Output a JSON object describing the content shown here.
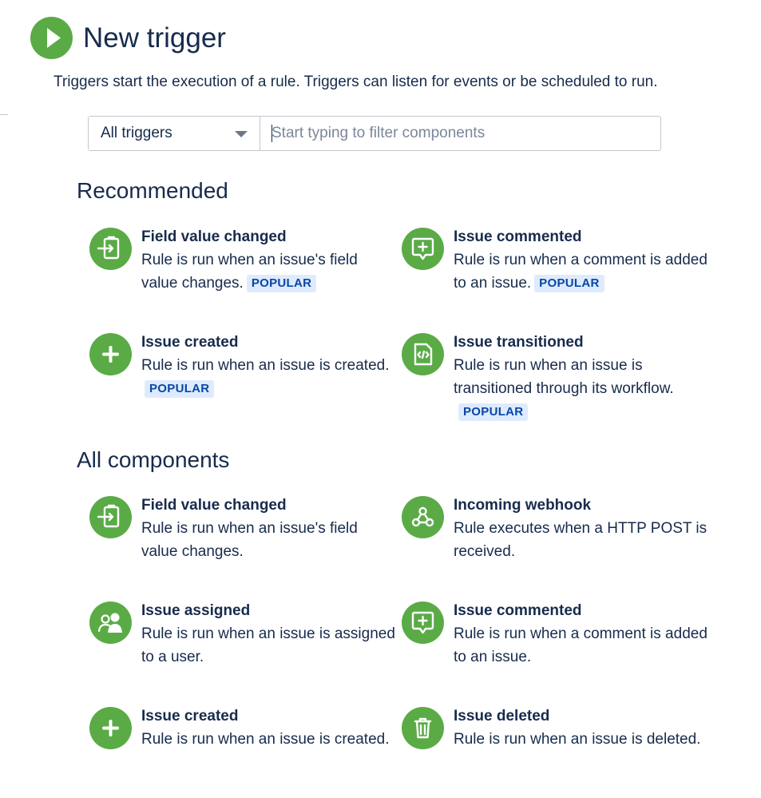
{
  "page": {
    "title": "New trigger",
    "description": "Triggers start the execution of a rule. Triggers can listen for events or be scheduled to run."
  },
  "filter": {
    "type_selected": "All triggers",
    "placeholder": "Start typing to filter components"
  },
  "badge": {
    "popular": "POPULAR"
  },
  "sections": {
    "recommended": {
      "title": "Recommended",
      "items": [
        {
          "icon": "field-change-icon",
          "title": "Field value changed",
          "desc": "Rule is run when an issue's field value changes."
        },
        {
          "icon": "comment-icon",
          "title": "Issue commented",
          "desc": "Rule is run when a comment is added to an issue."
        },
        {
          "icon": "plus-icon",
          "title": "Issue created",
          "desc": "Rule is run when an issue is created."
        },
        {
          "icon": "transition-icon",
          "title": "Issue transitioned",
          "desc": "Rule is run when an issue is transitioned through its workflow."
        }
      ]
    },
    "all": {
      "title": "All components",
      "items": [
        {
          "icon": "field-change-icon",
          "title": "Field value changed",
          "desc": "Rule is run when an issue's field value changes."
        },
        {
          "icon": "webhook-icon",
          "title": "Incoming webhook",
          "desc": "Rule executes when a HTTP POST is received."
        },
        {
          "icon": "users-icon",
          "title": "Issue assigned",
          "desc": "Rule is run when an issue is assigned to a user."
        },
        {
          "icon": "comment-icon",
          "title": "Issue commented",
          "desc": "Rule is run when a comment is added to an issue."
        },
        {
          "icon": "plus-icon",
          "title": "Issue created",
          "desc": "Rule is run when an issue is created."
        },
        {
          "icon": "trash-icon",
          "title": "Issue deleted",
          "desc": "Rule is run when an issue is deleted."
        }
      ]
    }
  },
  "colors": {
    "accent": "#5aab46",
    "text": "#172b4d",
    "badge_bg": "#deebff",
    "badge_text": "#0747a6"
  }
}
